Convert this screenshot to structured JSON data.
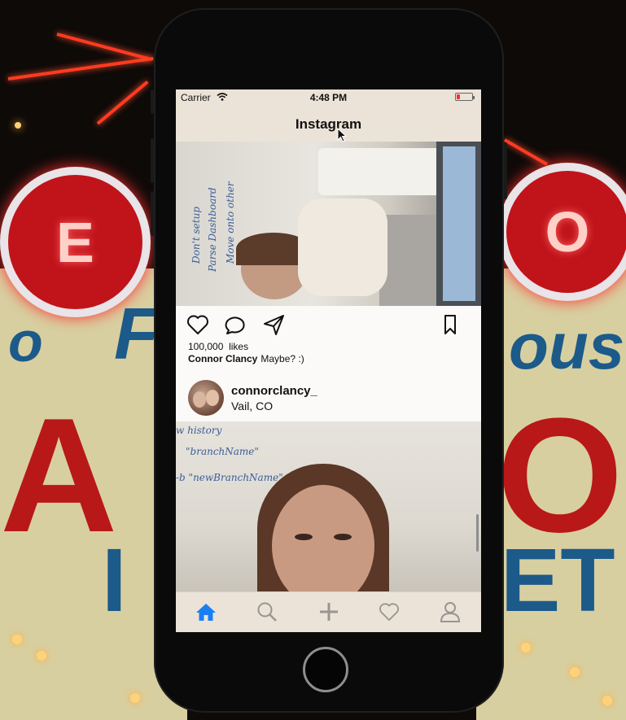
{
  "status_bar": {
    "carrier": "Carrier",
    "time": "4:48 PM",
    "battery_level": 0.2
  },
  "nav": {
    "title": "Instagram"
  },
  "posts": [
    {
      "likes_count": "100,000",
      "likes_label": "likes",
      "caption_user": "Connor Clancy",
      "caption_text": "Maybe? :)"
    },
    {
      "username": "connorclancy_",
      "location": "Vail, CO"
    }
  ],
  "actions": [
    "heart-icon",
    "comment-icon",
    "send-icon",
    "bookmark-icon"
  ],
  "tabs": [
    "home-icon",
    "search-icon",
    "add-icon",
    "heart-icon",
    "profile-icon"
  ],
  "colors": {
    "accent": "#1a7ff2",
    "nav_bg": "#ece3d8",
    "icon_inactive": "#9a9590"
  }
}
